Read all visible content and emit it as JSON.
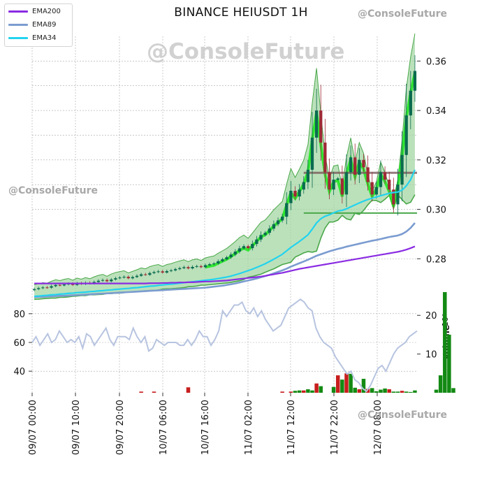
{
  "title": "BINANCE HEIUSDT 1H",
  "watermarks": [
    "@ConsoleFuture",
    "@ConsoleFuture",
    "@ConsoleFuture",
    "@ConsoleFuture"
  ],
  "legend": [
    {
      "label": "EMA200",
      "color": "#8a2be2"
    },
    {
      "label": "EMA89",
      "color": "#7b9cd0"
    },
    {
      "label": "EMA34",
      "color": "#22d3ee"
    }
  ],
  "colors": {
    "up": "#0a6b4f",
    "down": "#9e2a36",
    "vol_up": "#138a13",
    "vol_down": "#c81e1e",
    "channel_fill": "#9ed49e",
    "channel_line": "#4aa84a",
    "bright_band": "#19e619",
    "resistance": "#7a5a5a",
    "osc": "#b7c4e0"
  },
  "chart_data": [
    {
      "type": "candlestick",
      "title": "BINANCE HEIUSDT 1H",
      "x_tick_labels": [
        "09/07 00:00",
        "09/07 10:00",
        "09/07 20:00",
        "10/07 06:00",
        "10/07 16:00",
        "11/07 02:00",
        "11/07 12:00",
        "11/07 22:00",
        "12/07 08:00"
      ],
      "price_ticks": [
        0.28,
        0.3,
        0.32,
        0.34,
        0.36
      ],
      "ylim": [
        0.2665,
        0.37
      ],
      "bars": 90,
      "close": [
        0.2677,
        0.2681,
        0.2684,
        0.2683,
        0.2689,
        0.2694,
        0.2692,
        0.2696,
        0.2699,
        0.2694,
        0.2701,
        0.2698,
        0.2703,
        0.27,
        0.2706,
        0.2711,
        0.2714,
        0.2709,
        0.2716,
        0.2721,
        0.2724,
        0.2727,
        0.2721,
        0.2726,
        0.2731,
        0.2737,
        0.2735,
        0.2742,
        0.2746,
        0.2749,
        0.2744,
        0.275,
        0.2753,
        0.2758,
        0.2762,
        0.2766,
        0.2761,
        0.2767,
        0.277,
        0.2766,
        0.2774,
        0.2778,
        0.2781,
        0.279,
        0.2798,
        0.2806,
        0.2817,
        0.2829,
        0.2842,
        0.2851,
        0.2843,
        0.286,
        0.2878,
        0.2896,
        0.2905,
        0.2922,
        0.294,
        0.2955,
        0.297,
        0.3025,
        0.3075,
        0.3052,
        0.308,
        0.311,
        0.316,
        0.329,
        0.34,
        0.327,
        0.315,
        0.308,
        0.312,
        0.3125,
        0.306,
        0.315,
        0.321,
        0.314,
        0.32,
        0.317,
        0.311,
        0.306,
        0.309,
        0.315,
        0.312,
        0.308,
        0.302,
        0.31,
        0.322,
        0.338,
        0.348,
        0.356
      ],
      "ema34": [
        0.2648,
        0.2649,
        0.2651,
        0.2652,
        0.2654,
        0.2655,
        0.2657,
        0.2658,
        0.266,
        0.2661,
        0.2663,
        0.2664,
        0.2665,
        0.2667,
        0.2668,
        0.267,
        0.2671,
        0.2673,
        0.2674,
        0.2676,
        0.2677,
        0.2679,
        0.268,
        0.2682,
        0.2683,
        0.2685,
        0.2687,
        0.2689,
        0.269,
        0.2692,
        0.2694,
        0.2696,
        0.2697,
        0.2699,
        0.2701,
        0.2703,
        0.2705,
        0.2707,
        0.2709,
        0.2711,
        0.2713,
        0.2715,
        0.2717,
        0.272,
        0.2723,
        0.2726,
        0.273,
        0.2735,
        0.274,
        0.2746,
        0.2752,
        0.2758,
        0.2765,
        0.2772,
        0.278,
        0.2789,
        0.2798,
        0.2808,
        0.2818,
        0.2832,
        0.2846,
        0.2858,
        0.287,
        0.2883,
        0.2897,
        0.292,
        0.2945,
        0.2962,
        0.2972,
        0.2978,
        0.2986,
        0.2993,
        0.2996,
        0.3002,
        0.301,
        0.3018,
        0.3026,
        0.3033,
        0.304,
        0.3045,
        0.305,
        0.3055,
        0.306,
        0.3065,
        0.3068,
        0.307,
        0.3078,
        0.3095,
        0.312,
        0.316
      ],
      "ema89": [
        0.2645,
        0.2646,
        0.2646,
        0.2647,
        0.2648,
        0.2649,
        0.265,
        0.265,
        0.2651,
        0.2652,
        0.2653,
        0.2654,
        0.2655,
        0.2656,
        0.2657,
        0.2658,
        0.2659,
        0.266,
        0.2661,
        0.2662,
        0.2663,
        0.2664,
        0.2665,
        0.2666,
        0.2667,
        0.2668,
        0.2669,
        0.267,
        0.2671,
        0.2672,
        0.2673,
        0.2674,
        0.2675,
        0.2676,
        0.2677,
        0.2678,
        0.2679,
        0.268,
        0.2681,
        0.2682,
        0.2683,
        0.2685,
        0.2687,
        0.2689,
        0.2691,
        0.2694,
        0.2697,
        0.27,
        0.2704,
        0.2708,
        0.2712,
        0.2716,
        0.272,
        0.2725,
        0.273,
        0.2735,
        0.2741,
        0.2747,
        0.2753,
        0.276,
        0.2768,
        0.2775,
        0.2782,
        0.2789,
        0.2796,
        0.2804,
        0.2812,
        0.2818,
        0.2824,
        0.283,
        0.2835,
        0.284,
        0.2844,
        0.2849,
        0.2853,
        0.2857,
        0.2861,
        0.2865,
        0.2869,
        0.2873,
        0.2876,
        0.288,
        0.2884,
        0.2888,
        0.2891,
        0.2894,
        0.29,
        0.291,
        0.2925,
        0.2945
      ],
      "ema200": [
        0.27,
        0.27,
        0.27,
        0.27,
        0.27,
        0.27,
        0.27,
        0.27,
        0.27,
        0.27,
        0.27,
        0.27,
        0.27,
        0.27,
        0.27,
        0.27,
        0.27,
        0.27,
        0.27,
        0.27,
        0.27,
        0.27,
        0.27,
        0.27,
        0.27,
        0.27,
        0.27,
        0.2701,
        0.2701,
        0.2701,
        0.2702,
        0.2702,
        0.2703,
        0.2703,
        0.2704,
        0.2704,
        0.2705,
        0.2705,
        0.2706,
        0.2707,
        0.2708,
        0.2708,
        0.2709,
        0.271,
        0.2711,
        0.2712,
        0.2714,
        0.2716,
        0.2718,
        0.272,
        0.2722,
        0.2724,
        0.2726,
        0.2728,
        0.2731,
        0.2734,
        0.2737,
        0.274,
        0.2743,
        0.2747,
        0.2751,
        0.2755,
        0.2759,
        0.2762,
        0.2765,
        0.2768,
        0.2771,
        0.2774,
        0.2777,
        0.278,
        0.2783,
        0.2786,
        0.2789,
        0.2792,
        0.2795,
        0.2798,
        0.2801,
        0.2804,
        0.2807,
        0.281,
        0.2813,
        0.2816,
        0.2819,
        0.2822,
        0.2825,
        0.2828,
        0.2832,
        0.2837,
        0.2843,
        0.285
      ],
      "resistance": {
        "value": 0.3148,
        "from_index": 63
      },
      "support": {
        "value": 0.2985,
        "from_index": 63
      },
      "oscillator": {
        "ticks": [
          40,
          60,
          80
        ],
        "ylim": [
          25,
          95
        ],
        "values": [
          60,
          64,
          58,
          62,
          66,
          60,
          62,
          68,
          64,
          60,
          62,
          60,
          64,
          56,
          66,
          64,
          58,
          62,
          66,
          70,
          62,
          58,
          64,
          64,
          64,
          62,
          70,
          64,
          60,
          64,
          54,
          56,
          62,
          60,
          58,
          60,
          60,
          60,
          58,
          58,
          62,
          58,
          62,
          68,
          64,
          64,
          58,
          62,
          68,
          82,
          78,
          82,
          86,
          86,
          88,
          82,
          80,
          84,
          78,
          82,
          76,
          72,
          68,
          70,
          72,
          78,
          84,
          86,
          88,
          90,
          88,
          84,
          82,
          70,
          64,
          60,
          58,
          56,
          50,
          46,
          42,
          38,
          40,
          34,
          32,
          28,
          26,
          30,
          36,
          42,
          44,
          40,
          46,
          52,
          56,
          58,
          60,
          64,
          66,
          68
        ]
      },
      "volume": {
        "ticks": [
          10,
          20
        ],
        "unit": "10^6",
        "label": "Volume",
        "ylim": [
          0,
          26
        ],
        "values": [
          0,
          0,
          0,
          0,
          0,
          0,
          0,
          0,
          0,
          0,
          0,
          0,
          0,
          0,
          0,
          0,
          0,
          0,
          0,
          0,
          0,
          0,
          0,
          0,
          0,
          0.3,
          0,
          0,
          0.3,
          0,
          0,
          0,
          0,
          0,
          0,
          0,
          1.4,
          0,
          0,
          0,
          0,
          0,
          0,
          0,
          0,
          0,
          0,
          0,
          0,
          0,
          0,
          0,
          0,
          0,
          0,
          0,
          0,
          0,
          0.3,
          0,
          0.3,
          0.5,
          0.6,
          0.6,
          0.9,
          0.6,
          2.4,
          1.7,
          0,
          0,
          1.5,
          4.5,
          3.4,
          5.0,
          4.9,
          1.3,
          0.9,
          3.6,
          1.0,
          1.2,
          0.4,
          0.8,
          1.1,
          0.9,
          0.3,
          0.3,
          0.5,
          0.3,
          0.2,
          0.6,
          0,
          0,
          0,
          0,
          0.8,
          4.5,
          26.0,
          15.0,
          1.2,
          0
        ],
        "colors_down_idx": [
          25,
          28,
          36,
          58,
          60,
          63,
          66,
          71,
          73,
          76,
          78,
          83,
          86
        ]
      }
    }
  ]
}
